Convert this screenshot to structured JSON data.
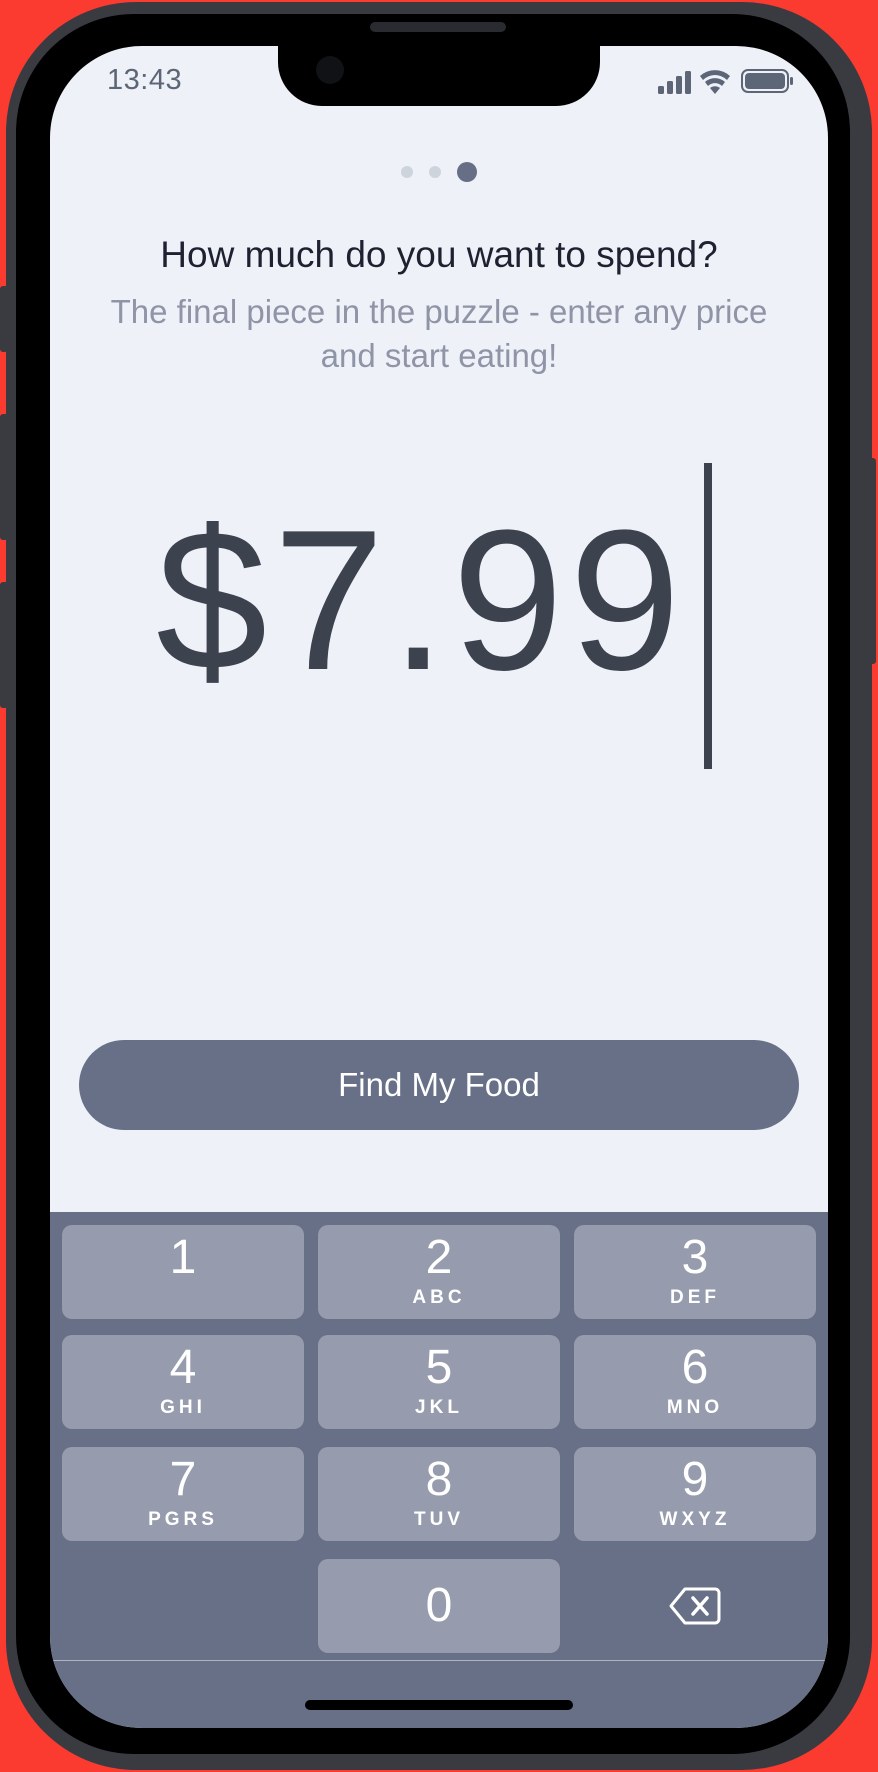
{
  "status_bar": {
    "time": "13:43",
    "signal_icon": "cellular-signal-icon",
    "wifi_icon": "wifi-icon",
    "battery_icon": "battery-icon"
  },
  "pager": {
    "total": 3,
    "active_index": 2
  },
  "header": {
    "title": "How much do you want to spend?",
    "subtitle": "The final piece in the puzzle - enter any price and start eating!"
  },
  "price_input": {
    "value": "$7.99"
  },
  "cta": {
    "label": "Find My Food"
  },
  "keypad": {
    "keys": [
      {
        "num": "1",
        "letters": ""
      },
      {
        "num": "2",
        "letters": "ABC"
      },
      {
        "num": "3",
        "letters": "DEF"
      },
      {
        "num": "4",
        "letters": "GHI"
      },
      {
        "num": "5",
        "letters": "JKL"
      },
      {
        "num": "6",
        "letters": "MNO"
      },
      {
        "num": "7",
        "letters": "PGRS"
      },
      {
        "num": "8",
        "letters": "TUV"
      },
      {
        "num": "9",
        "letters": "WXYZ"
      },
      {
        "num": "0",
        "letters": ""
      }
    ],
    "backspace_icon": "backspace-icon"
  },
  "colors": {
    "background": "#eef1f8",
    "accent": "#677087",
    "key": "#969cad",
    "price_text": "#3d424f",
    "frame_bg": "#fb3b30"
  }
}
